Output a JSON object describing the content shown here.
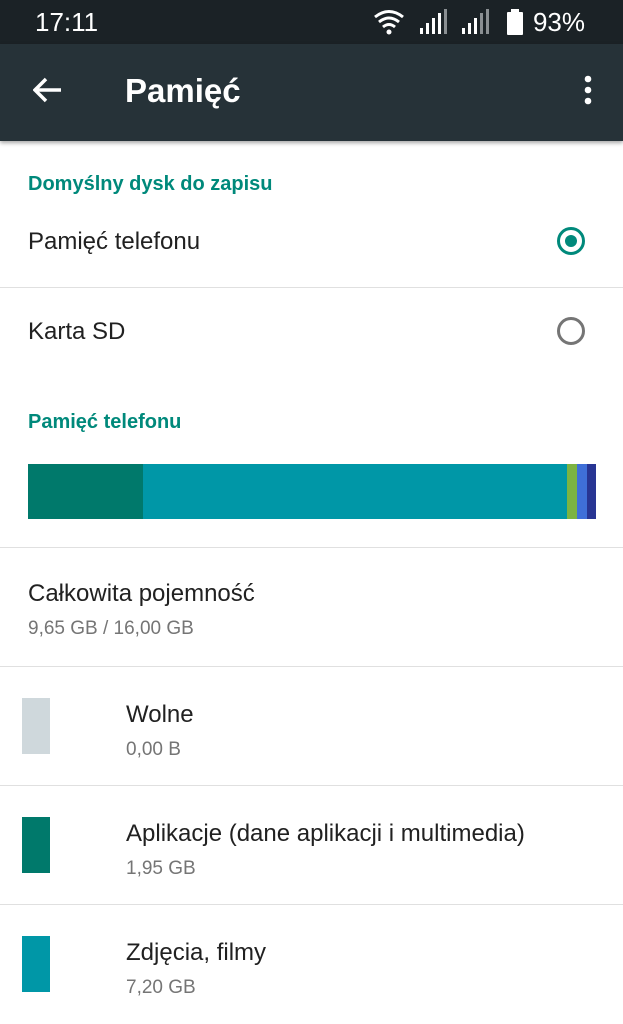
{
  "status_bar": {
    "time": "17:11",
    "battery": "93%",
    "icons": [
      "wifi-icon",
      "signal-icon",
      "signal-icon",
      "battery-icon"
    ]
  },
  "app_bar": {
    "title": "Pamięć",
    "back_icon": "arrow-back-icon",
    "menu_icon": "more-vert-icon"
  },
  "default_storage": {
    "header": "Domyślny dysk do zapisu",
    "options": [
      {
        "label": "Pamięć telefonu",
        "selected": true
      },
      {
        "label": "Karta SD",
        "selected": false
      }
    ]
  },
  "phone_storage": {
    "header": "Pamięć telefonu",
    "bar_segments": [
      {
        "name": "apps",
        "fraction": 0.2025,
        "color": "#00796b"
      },
      {
        "name": "photos",
        "fraction": 0.7465,
        "color": "#0097a7"
      },
      {
        "name": "green",
        "fraction": 0.018,
        "color": "#7cb342"
      },
      {
        "name": "blue",
        "fraction": 0.018,
        "color": "#3f6fd8"
      },
      {
        "name": "navy",
        "fraction": 0.015,
        "color": "#283593"
      }
    ],
    "total_label": "Całkowita pojemność",
    "total_value": "9,65 GB / 16,00 GB",
    "categories": [
      {
        "label": "Wolne",
        "value": "0,00 B",
        "color": "#cfd8dc"
      },
      {
        "label": "Aplikacje (dane aplikacji i multimedia)",
        "value": "1,95 GB",
        "color": "#00796b"
      },
      {
        "label": "Zdjęcia, filmy",
        "value": "7,20 GB",
        "color": "#0097a7"
      }
    ]
  },
  "colors": {
    "accent": "#00897b",
    "app_bar": "#263238",
    "status_bar": "#1b2226"
  }
}
